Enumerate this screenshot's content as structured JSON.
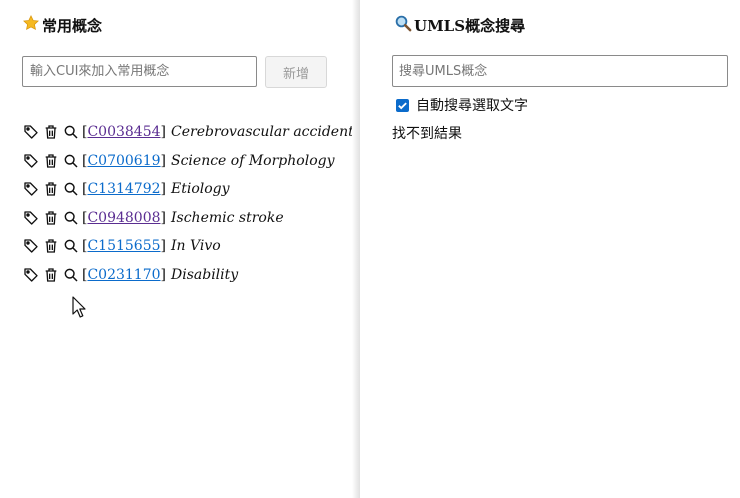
{
  "favorites": {
    "title": "常用概念",
    "input_placeholder": "輸入CUI來加入常用概念",
    "add_button": "新增",
    "items": [
      {
        "cui": "C0038454",
        "name": "Cerebrovascular accident"
      },
      {
        "cui": "C0700619",
        "name": "Science of Morphology"
      },
      {
        "cui": "C1314792",
        "name": "Etiology"
      },
      {
        "cui": "C0948008",
        "name": "Ischemic stroke"
      },
      {
        "cui": "C1515655",
        "name": "In Vivo"
      },
      {
        "cui": "C0231170",
        "name": "Disability"
      }
    ]
  },
  "search": {
    "title": "UMLS概念搜尋",
    "input_placeholder": "搜尋UMLS概念",
    "auto_search_label": "自動搜尋選取文字",
    "auto_search_checked": true,
    "no_results": "找不到結果"
  },
  "colors": {
    "link": "#0b6bcb",
    "visited_link": "#5a2d91",
    "checkbox": "#0b6bcb",
    "star": "#f5b921"
  },
  "icons": [
    "star-icon",
    "magnifier-icon",
    "tag-icon",
    "trash-icon",
    "search-icon",
    "mouse-cursor-icon"
  ]
}
